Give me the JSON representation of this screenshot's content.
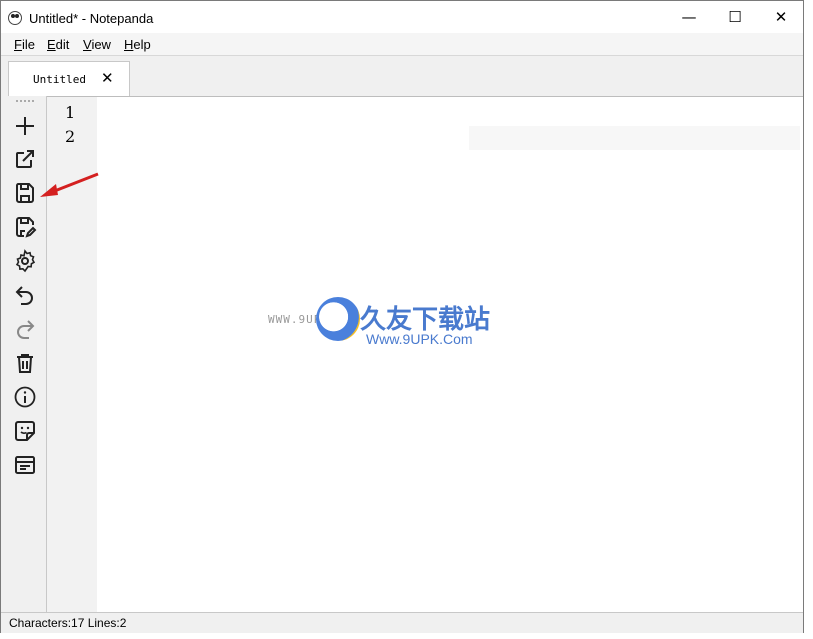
{
  "window": {
    "title": "Untitled* - Notepanda",
    "controls": {
      "minimize": "—",
      "maximize": "☐",
      "close": "✕"
    }
  },
  "menu": {
    "items": [
      {
        "key": "F",
        "rest": "ile"
      },
      {
        "key": "E",
        "rest": "dit"
      },
      {
        "key": "V",
        "rest": "iew"
      },
      {
        "key": "H",
        "rest": "elp"
      }
    ]
  },
  "tabs": [
    {
      "label": "Untitled",
      "close": "✕"
    }
  ],
  "toolbar": {
    "items": [
      "new-icon",
      "open-external-icon",
      "save-icon",
      "save-as-icon",
      "settings-icon",
      "undo-icon",
      "redo-icon",
      "delete-icon",
      "info-icon",
      "sticker-icon",
      "layout-icon"
    ]
  },
  "editor": {
    "line_numbers": [
      "1",
      "2"
    ]
  },
  "status": {
    "text": "Characters:17 Lines:2"
  },
  "watermark": {
    "brand": "久友下载站",
    "url_left": "WWW.9UPK.COM",
    "url_right": "Www.9UPK.Com",
    "colors": {
      "blue": "#2a63c6",
      "gold": "#f5b400"
    }
  },
  "annotation": {
    "arrow_color": "#d42020"
  }
}
